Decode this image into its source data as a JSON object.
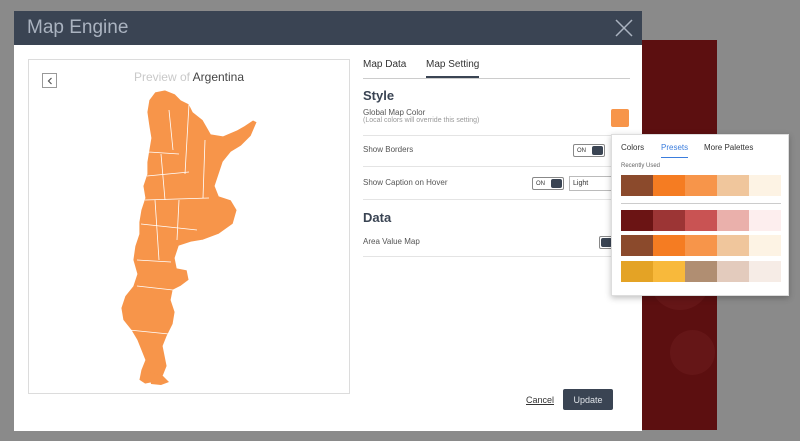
{
  "modal": {
    "title": "Map Engine",
    "close_icon": "close-icon"
  },
  "preview": {
    "title_prefix": "Preview of",
    "country": "Argentina",
    "back_icon": "chevron-left-icon",
    "map_color": "#f7954a"
  },
  "tabs": [
    {
      "label": "Map Data",
      "active": false
    },
    {
      "label": "Map Setting",
      "active": true
    }
  ],
  "style_section": {
    "heading": "Style",
    "global_color_label": "Global Map Color",
    "global_color_note": "(Local colors will override this setting)",
    "global_color": "#f7954a",
    "show_borders_label": "Show Borders",
    "show_borders_toggle": "ON",
    "show_caption_label": "Show Caption on Hover",
    "show_caption_toggle": "ON",
    "caption_select_value": "Light"
  },
  "data_section": {
    "heading": "Data",
    "area_value_label": "Area Value Map"
  },
  "footer": {
    "cancel_label": "Cancel",
    "update_label": "Update"
  },
  "palette": {
    "tabs": [
      {
        "label": "Colors",
        "active": false
      },
      {
        "label": "Presets",
        "active": true
      },
      {
        "label": "More Palettes",
        "active": false
      }
    ],
    "recently_used_label": "Recently Used",
    "recently_used": [
      "#8b4a2c",
      "#f57c22",
      "#f7954a",
      "#f0c69c",
      "#fdf3e4"
    ],
    "presets": [
      [
        "#6b1414",
        "#9c3535",
        "#c95353",
        "#eab0ab",
        "#fdeeee"
      ],
      [
        "#8b4a2c",
        "#f57c22",
        "#f7954a",
        "#f0c69c",
        "#fdf3e4"
      ],
      [
        "#e4a325",
        "#f8b93b",
        "#b08e72",
        "#e3cbbd",
        "#f6ece6"
      ]
    ]
  }
}
